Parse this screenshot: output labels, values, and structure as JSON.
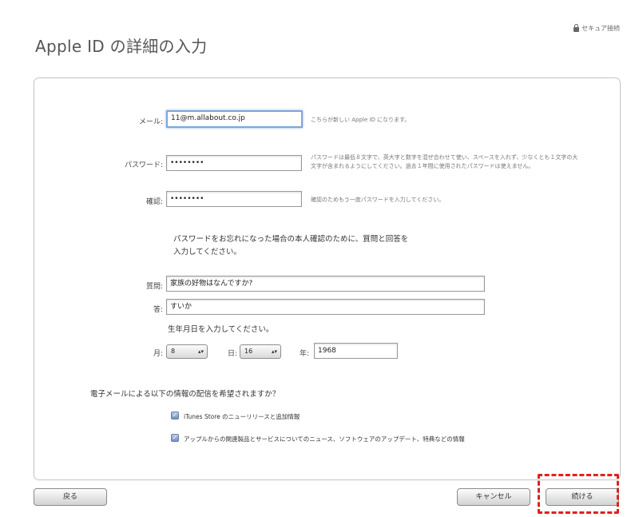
{
  "header": {
    "title": "Apple ID の詳細の入力",
    "secure_label": "セキュア接続",
    "secure_icon": "lock-icon"
  },
  "form": {
    "email": {
      "label": "メール:",
      "value": "11@m.allabout.co.jp",
      "hint": "こちらが新しい Apple ID になります。"
    },
    "password": {
      "label": "パスワード:",
      "value": "••••••••",
      "hint": "パスワードは最低８文字で、英大字と数字を混ぜ合わせて使い、スペースを入れず、少なくとも１文字の大文字が含まれるようにしてください。過去１年間に使用されたパスワードは使えません。"
    },
    "confirm": {
      "label": "確認:",
      "value": "••••••••",
      "hint": "確認のためもう一度パスワードを入力してください。"
    },
    "security_intro": "パスワードをお忘れになった場合の本人確認のために、質問と回答を入力してください。",
    "question": {
      "label": "質問:",
      "value": "家族の好物はなんですか?"
    },
    "answer": {
      "label": "答:",
      "value": "すいか"
    },
    "birthday_intro": "生年月日を入力してください。",
    "month": {
      "label": "月:",
      "value": "8"
    },
    "day": {
      "label": "日:",
      "value": "16"
    },
    "year": {
      "label": "年:",
      "value": "1968"
    },
    "email_prefs_question": "電子メールによる以下の情報の配信を希望されますか？",
    "checkboxes": [
      {
        "label": "iTunes Store のニューリリースと追加情報",
        "checked": true
      },
      {
        "label": "アップルからの関連製品とサービスについてのニュース、ソフトウェアのアップデート、特典などの情報",
        "checked": true
      }
    ]
  },
  "buttons": {
    "back": "戻る",
    "cancel": "キャンセル",
    "continue": "続ける"
  },
  "accent_colors": {
    "focus_ring": "#7fa6d8",
    "highlight": "#e02020",
    "checkbox": "#6f90c9"
  }
}
